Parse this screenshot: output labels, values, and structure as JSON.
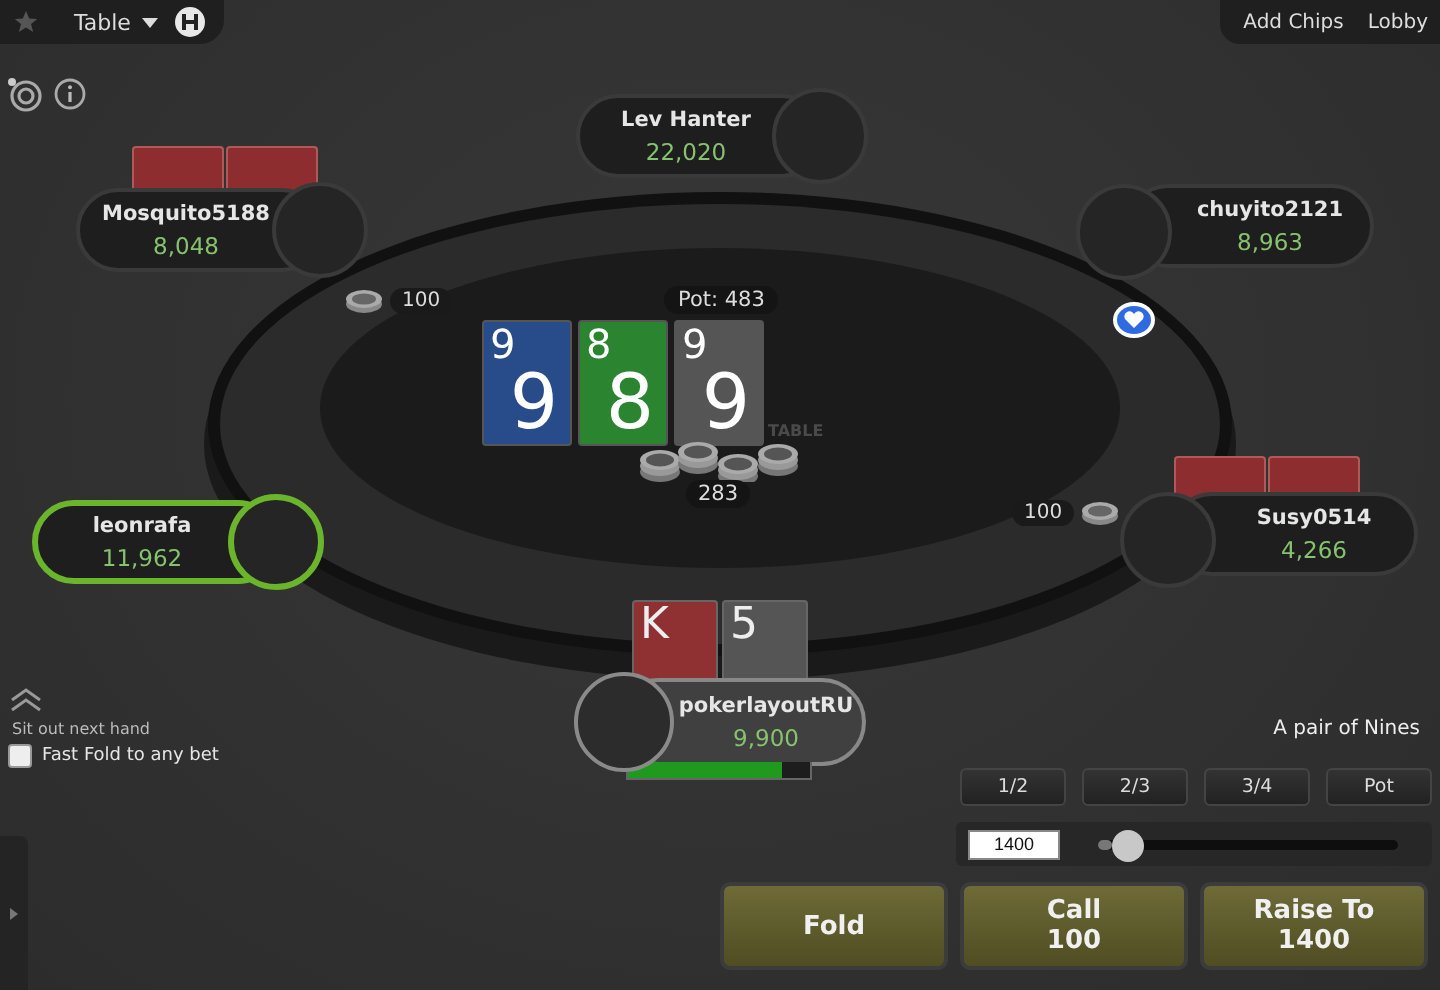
{
  "top_bar": {
    "menu": "Table",
    "right_links": [
      "Add Chips",
      "Lobby"
    ]
  },
  "table_logo": "TABLE",
  "seats": [
    {
      "name": "Lev Hanter",
      "stack": "22,020",
      "active": false,
      "holding": false
    },
    {
      "name": "Mosquito5188",
      "stack": "8,048",
      "active": false,
      "holding": true
    },
    {
      "name": "chuyito2121",
      "stack": "8,963",
      "active": false,
      "holding": false
    },
    {
      "name": "leonrafa",
      "stack": "11,962",
      "active": true,
      "holding": false
    },
    {
      "name": "Susy0514",
      "stack": "4,266",
      "active": false,
      "holding": true
    }
  ],
  "bets": [
    {
      "amount": "100"
    },
    {
      "amount": "100"
    }
  ],
  "pot": "Pot: 483",
  "board": [
    {
      "corner": "9",
      "center": "9",
      "color": "#284c8a"
    },
    {
      "corner": "8",
      "center": "8",
      "color": "#2a8430"
    },
    {
      "corner": "9",
      "center": "9",
      "color": "#555555"
    }
  ],
  "pot_chips": "283",
  "hero": {
    "name": "pokerlayoutRU",
    "stack": "9,900",
    "level": 0.85,
    "cards": [
      {
        "corner": "K",
        "color": "#8f3033"
      },
      {
        "corner": "5",
        "color": "#555555"
      }
    ]
  },
  "sit_out": "Sit out next hand",
  "fast_fold": {
    "label": "Fast Fold to any bet",
    "checked": false
  },
  "hand_label": "A pair of Nines",
  "presets": [
    "1/2",
    "2/3",
    "3/4",
    "Pot"
  ],
  "bet_input": {
    "value": "1400"
  },
  "bet_slider": {
    "level": 0.1
  },
  "actions": [
    {
      "label": "Fold"
    },
    {
      "label": "Call",
      "amount": "100"
    },
    {
      "label": "Raise To",
      "amount": "1400"
    }
  ]
}
